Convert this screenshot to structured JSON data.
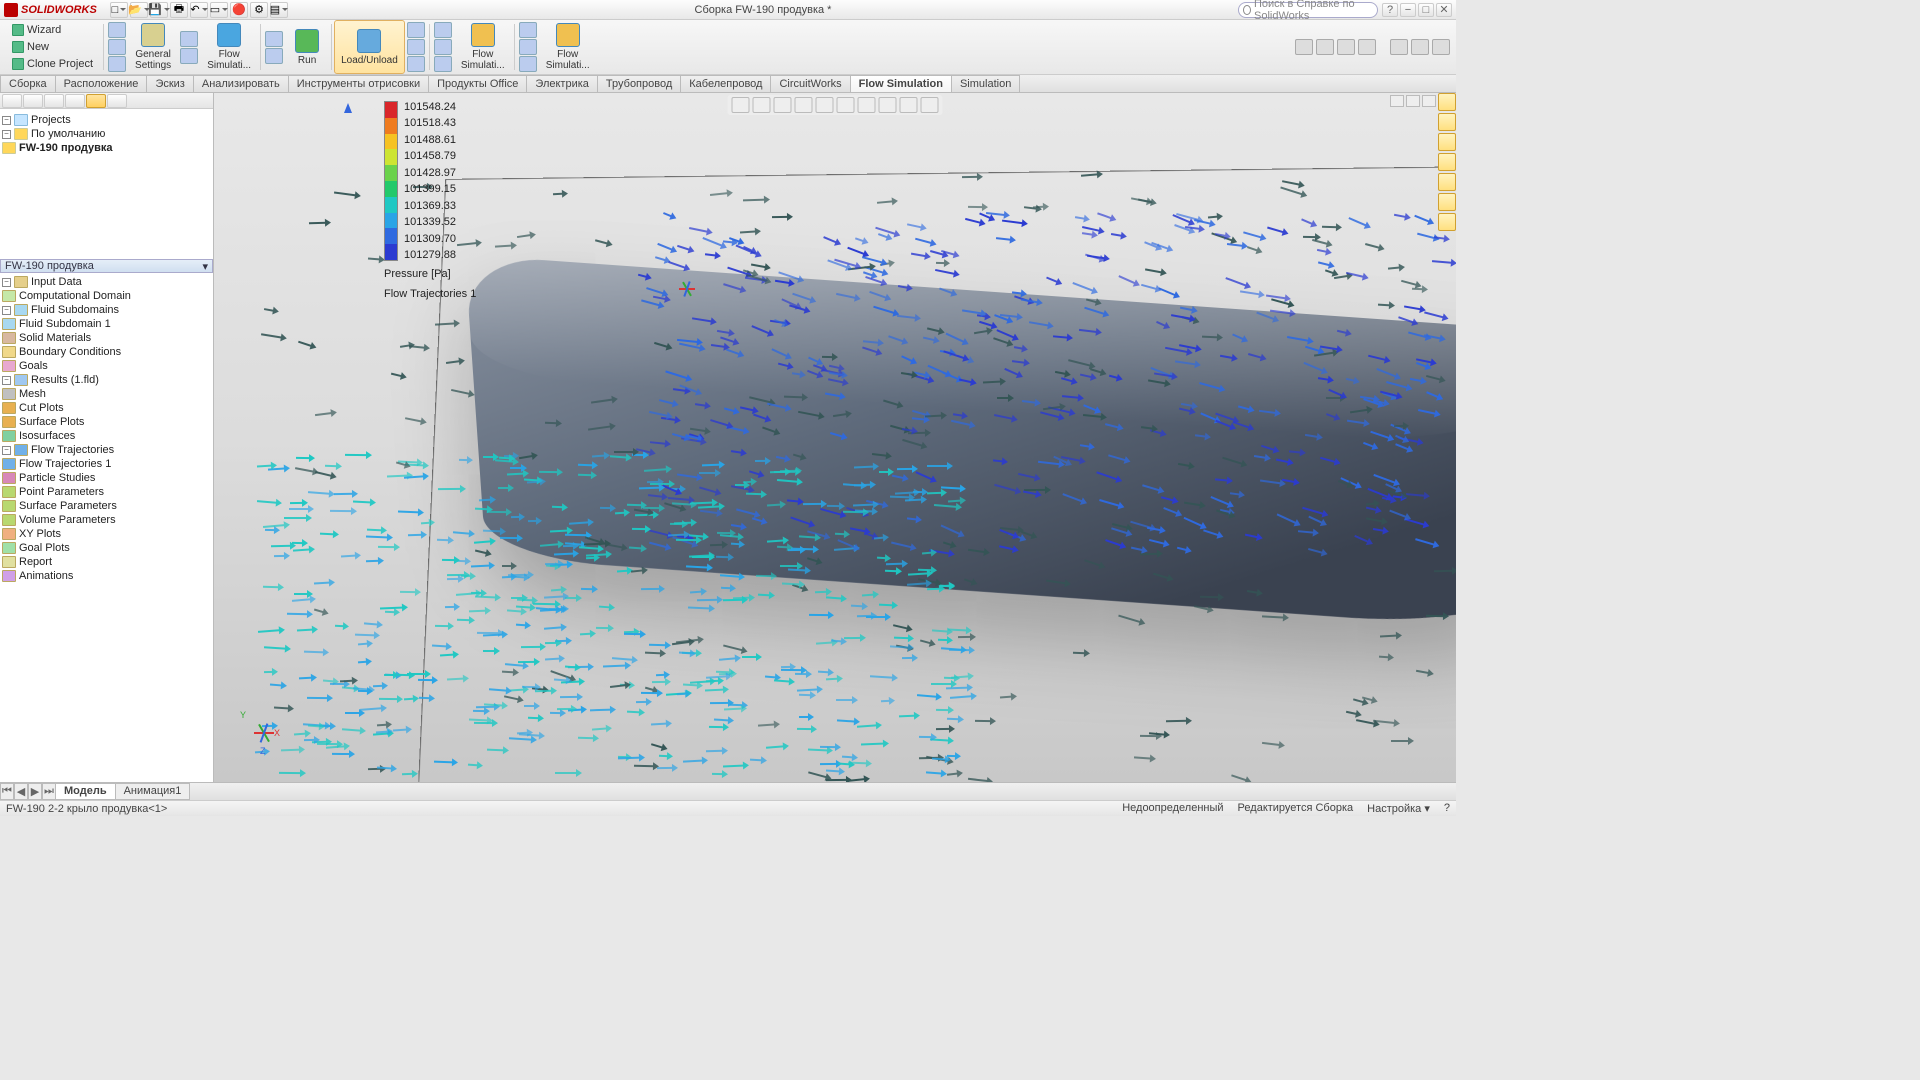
{
  "app": {
    "name": "SOLIDWORKS",
    "title": "Сборка FW-190 продувка *"
  },
  "search": {
    "placeholder": "Поиск в Справке по SolidWorks"
  },
  "menus": {
    "wizard": "Wizard",
    "new": "New",
    "clone": "Clone Project",
    "general": "General\nSettings",
    "flowsim_dd": "Flow\nSimulati...",
    "run": "Run",
    "load": "Load/Unload",
    "flowsim2": "Flow\nSimulati...",
    "flowsim3": "Flow\nSimulati..."
  },
  "tabs": [
    "Сборка",
    "Расположение",
    "Эскиз",
    "Анализировать",
    "Инструменты отрисовки",
    "Продукты Office",
    "Электрика",
    "Трубопровод",
    "Кабелепровод",
    "CircuitWorks",
    "Flow Simulation",
    "Simulation"
  ],
  "active_tab": "Flow Simulation",
  "projects": {
    "root": "Projects",
    "default": "По умолчанию",
    "config": "FW-190 продувка"
  },
  "study_bar": "FW-190 продувка",
  "study_tree": {
    "input": "Input Data",
    "comp": "Computational Domain",
    "fluid": "Fluid Subdomains",
    "fluid1": "Fluid Subdomain 1",
    "solid": "Solid Materials",
    "bc": "Boundary Conditions",
    "goals": "Goals",
    "results": "Results (1.fld)",
    "mesh": "Mesh",
    "cut": "Cut Plots",
    "surf": "Surface Plots",
    "iso": "Isosurfaces",
    "ft": "Flow Trajectories",
    "ft1": "Flow Trajectories 1",
    "ps": "Particle Studies",
    "pp": "Point Parameters",
    "sp": "Surface Parameters",
    "vp": "Volume Parameters",
    "xy": "XY Plots",
    "gp": "Goal Plots",
    "rep": "Report",
    "anim": "Animations"
  },
  "legend": {
    "vals": [
      "101548.24",
      "101518.43",
      "101488.61",
      "101458.79",
      "101428.97",
      "101399.15",
      "101369.33",
      "101339.52",
      "101309.70",
      "101279.88"
    ],
    "label": "Pressure [Pa]",
    "plot": "Flow Trajectories 1",
    "colors": [
      "#d9262a",
      "#ef7b1f",
      "#f6c222",
      "#cde432",
      "#6ad24b",
      "#22c96b",
      "#1fc8c3",
      "#29a4e6",
      "#2f6ae0",
      "#2b3bd1"
    ]
  },
  "bottom_tabs": {
    "model": "Модель",
    "anim": "Анимация1"
  },
  "status": {
    "left": "FW-190 2-2 крыло продувка<1>",
    "r1": "Недоопределенный",
    "r2": "Редактируется Сборка",
    "r3": "Настройка"
  }
}
